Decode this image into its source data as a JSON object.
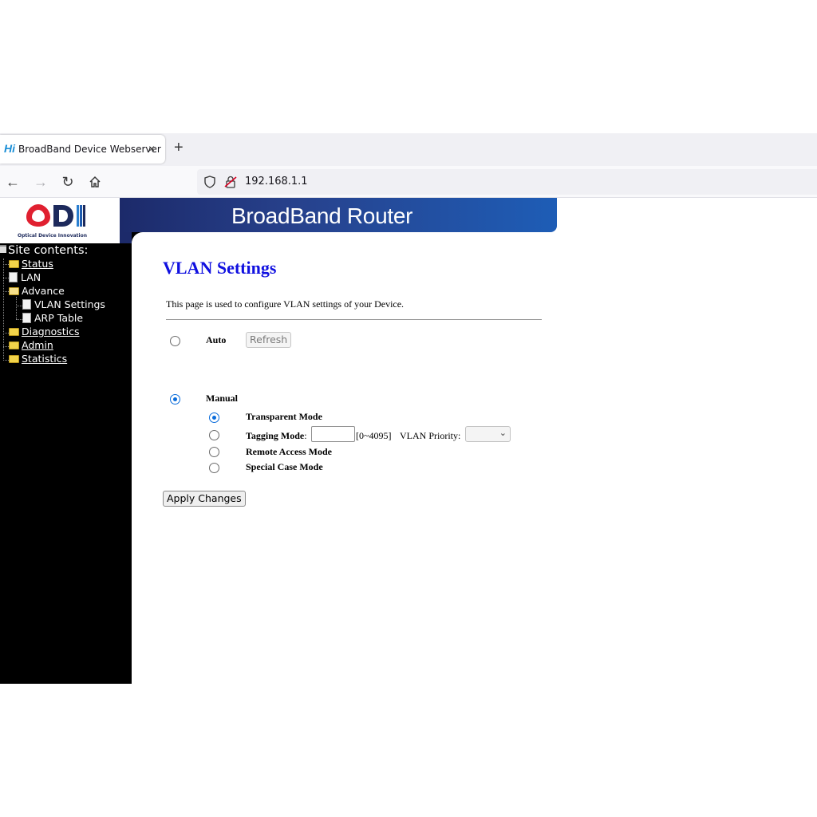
{
  "browser": {
    "tab_title": "BroadBand Device Webserver",
    "favicon_text": "Hi",
    "tab_close": "×",
    "new_tab": "+",
    "url": "192.168.1.1"
  },
  "header": {
    "logo_text": "ODI",
    "logo_subtitle": "Optical Device Innovation",
    "banner_title": "BroadBand Router"
  },
  "sidebar": {
    "title": "Site contents:",
    "items": [
      {
        "label": "Status",
        "icon": "folder-icon"
      },
      {
        "label": "LAN",
        "icon": "document-icon"
      },
      {
        "label": "Advance",
        "icon": "folder-open-icon"
      },
      {
        "label": "VLAN Settings",
        "icon": "document-icon"
      },
      {
        "label": "ARP Table",
        "icon": "document-icon"
      },
      {
        "label": "Diagnostics",
        "icon": "folder-icon"
      },
      {
        "label": "Admin",
        "icon": "folder-icon"
      },
      {
        "label": "Statistics",
        "icon": "folder-icon"
      }
    ]
  },
  "main": {
    "title": "VLAN Settings",
    "description": "This page is used to configure VLAN settings of your Device.",
    "auto_label": "Auto",
    "refresh_label": "Refresh",
    "manual_label": "Manual",
    "transparent_label": "Transparent Mode",
    "tagging_label": "Tagging Mode",
    "tagging_colon": ":",
    "vlan_range": "[0~4095]",
    "vlan_priority_label": "VLAN Priority:",
    "remote_label": "Remote Access Mode",
    "special_label": "Special Case Mode",
    "apply_label": "Apply Changes",
    "vlan_id_value": "",
    "vlan_priority_value": ""
  },
  "colors": {
    "title_blue": "#1010e0",
    "radio_blue": "#0a6cdb",
    "banner_blue": "#1e5db6"
  }
}
